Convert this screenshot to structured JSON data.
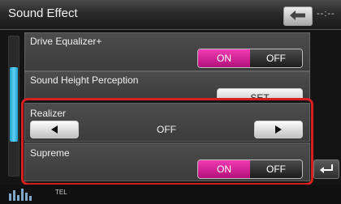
{
  "header": {
    "title": "Sound Effect",
    "time": "--:--"
  },
  "items": {
    "drive_eq": {
      "label": "Drive Equalizer+",
      "on": "ON",
      "off": "OFF",
      "state": "ON"
    },
    "height": {
      "label": "Sound Height Perception",
      "button": "SET"
    },
    "realizer": {
      "label": "Realizer",
      "value": "OFF"
    },
    "supreme": {
      "label": "Supreme",
      "on": "ON",
      "off": "OFF",
      "state": "ON"
    }
  },
  "footer": {
    "tel": "TEL"
  },
  "icons": {
    "back": "back-arrow-icon",
    "left": "triangle-left-icon",
    "right": "triangle-right-icon",
    "return": "return-arrow-icon",
    "equalizer": "equalizer-bars-icon"
  },
  "colors": {
    "on_active": "#d61e97",
    "highlight": "#d61f1f",
    "scroll": "#2aa9d6"
  }
}
